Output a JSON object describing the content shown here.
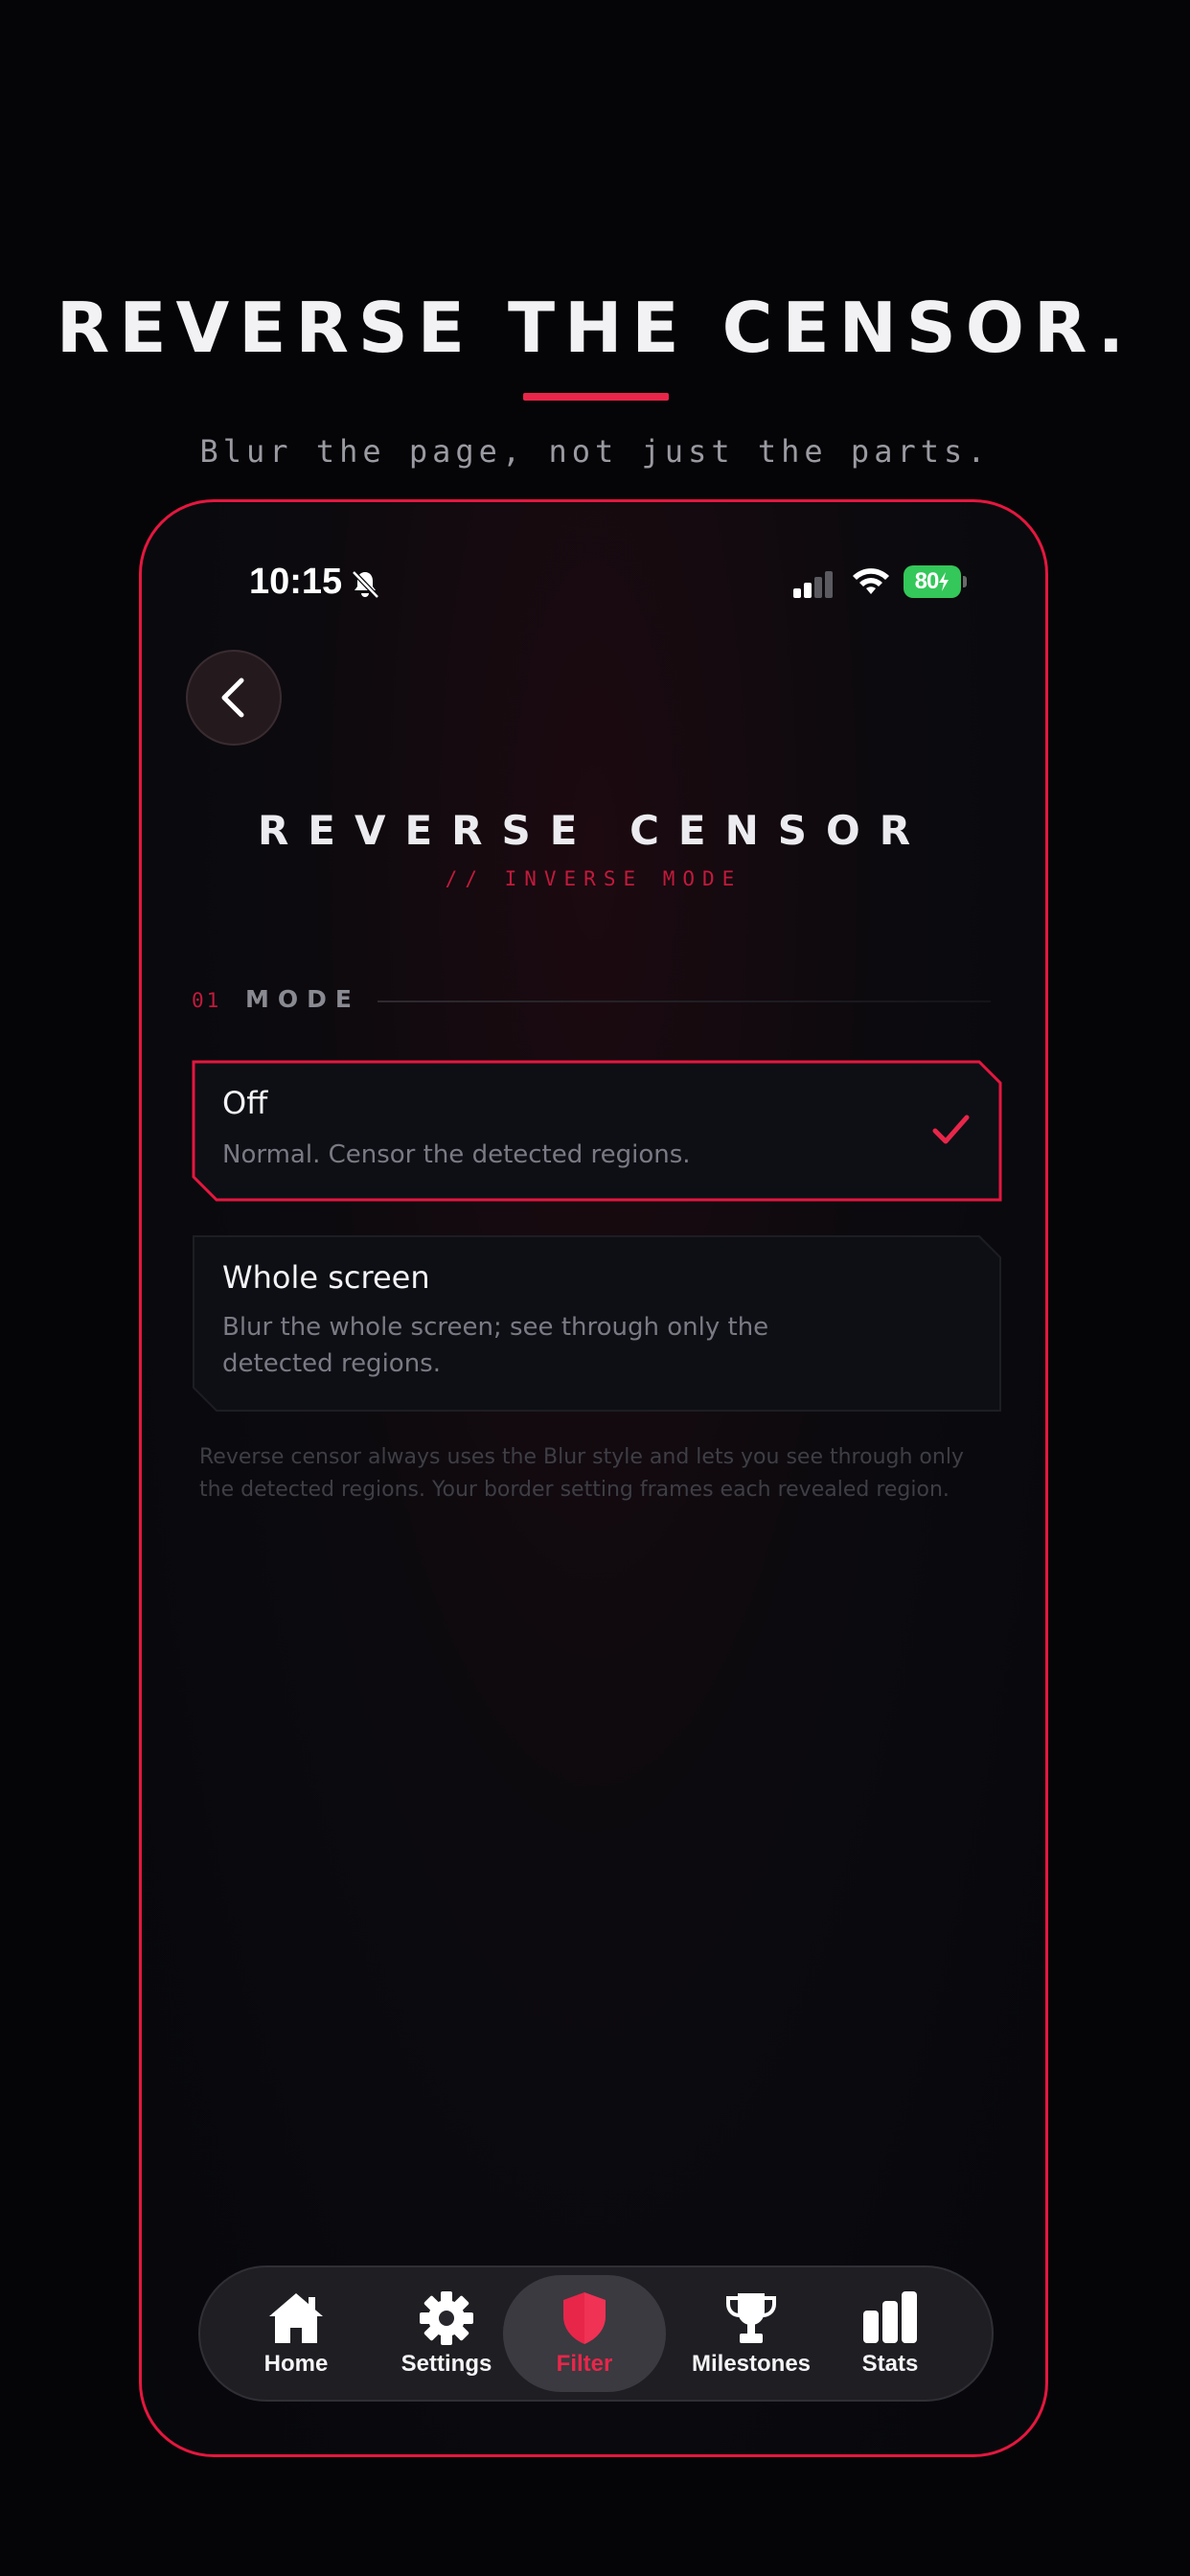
{
  "promo": {
    "headline": "REVERSE THE CENSOR.",
    "subheadline": "Blur the page, not just the parts."
  },
  "status_bar": {
    "time": "10:15",
    "battery": "80"
  },
  "screen": {
    "title": "REVERSE CENSOR",
    "subtitle": "// INVERSE MODE"
  },
  "section": {
    "number": "01",
    "label": "MODE"
  },
  "options": [
    {
      "title": "Off",
      "description": "Normal. Censor the detected regions.",
      "selected": true
    },
    {
      "title": "Whole screen",
      "description": "Blur the whole screen; see through only the detected regions.",
      "selected": false
    }
  ],
  "footnote": "Reverse censor always uses the Blur style and lets you see through only the detected regions. Your border setting frames each revealed region.",
  "tabbar": {
    "tabs": [
      {
        "label": "Home",
        "icon": "home-icon"
      },
      {
        "label": "Settings",
        "icon": "gear-icon"
      },
      {
        "label": "Filter",
        "icon": "shield-icon",
        "active": true
      },
      {
        "label": "Milestones",
        "icon": "trophy-icon"
      },
      {
        "label": "Stats",
        "icon": "bar-chart-icon"
      }
    ]
  },
  "colors": {
    "accent": "#e8264a",
    "background": "#050507",
    "battery_green": "#34c759"
  }
}
